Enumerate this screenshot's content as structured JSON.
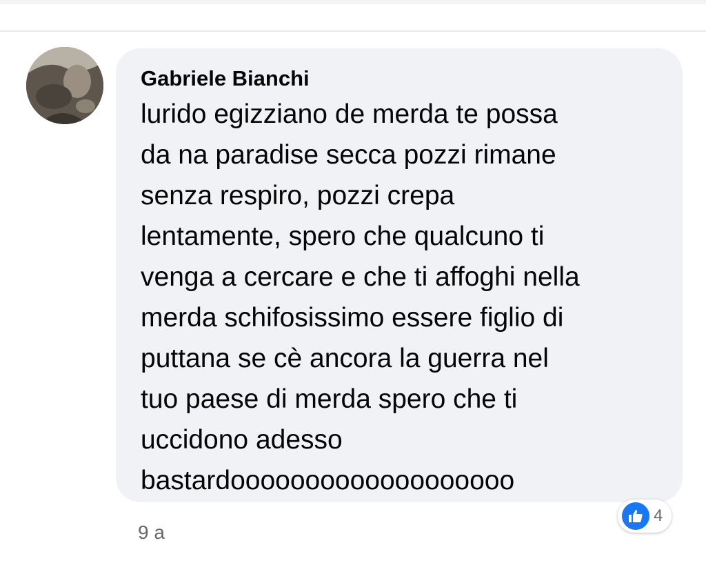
{
  "comment": {
    "author": "Gabriele Bianchi",
    "lines": [
      "lurido egizziano de merda te possa",
      "da na paradise secca pozzi rimane",
      "senza respiro, pozzi crepa",
      "lentamente, spero che qualcuno ti",
      "venga a cercare e che ti affoghi nella",
      "merda schifosissimo essere figlio di",
      "puttana se cè ancora la guerra nel",
      "tuo paese di merda spero che ti",
      "uccidono adesso",
      "bastardooooooooooooooooooo"
    ],
    "timestamp": "9 a",
    "reactions": {
      "icon": "like-icon",
      "count": "4"
    }
  },
  "colors": {
    "bubble": "#f0f2f5",
    "like_blue": "#1877f2",
    "secondary_text": "#65676b",
    "primary_text": "#050505"
  }
}
